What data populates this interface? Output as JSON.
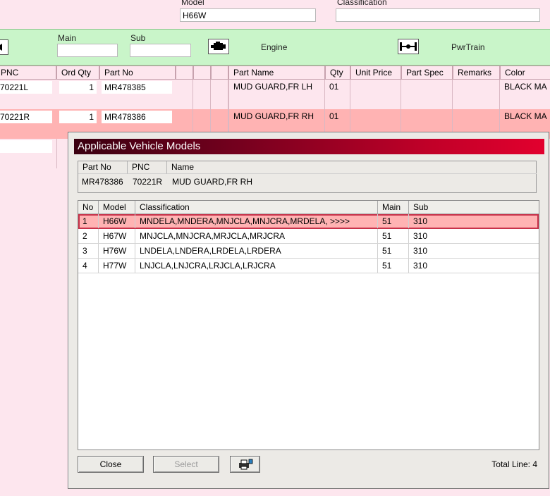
{
  "top": {
    "model_label": "Model",
    "model_value": "H66W",
    "classification_label": "Classification",
    "classification_value": ""
  },
  "toolbar": {
    "main_label": "Main",
    "sub_label": "Sub",
    "engine_label": "Engine",
    "pwrtrain_label": "PwrTrain",
    "engine_icon": "engine-icon",
    "pwrtrain_icon": "axle-icon",
    "colors": {
      "toolbar_bg": "#c9f5c9",
      "page_bg": "#fde6ee",
      "selected_row": "#ffb3b3"
    }
  },
  "parts_grid": {
    "headers": {
      "pnc": "PNC",
      "ord_qty": "Ord Qty",
      "part_no": "Part No",
      "part_name": "Part Name",
      "qty": "Qty",
      "unit_price": "Unit Price",
      "part_spec": "Part Spec",
      "remarks": "Remarks",
      "color": "Color"
    },
    "rows": [
      {
        "pnc": "70221L",
        "ord_qty": "1",
        "part_no": "MR478385",
        "part_name": "MUD GUARD,FR LH",
        "qty": "01",
        "color": "BLACK MA"
      },
      {
        "pnc": "70221R",
        "ord_qty": "1",
        "part_no": "MR478386",
        "part_name": "MUD GUARD,FR RH",
        "qty": "01",
        "color": "BLACK MA"
      }
    ]
  },
  "dialog": {
    "title": "Applicable Vehicle Models",
    "info_headers": {
      "part_no": "Part No",
      "pnc": "PNC",
      "name": "Name"
    },
    "info_values": {
      "part_no": "MR478386",
      "pnc": "70221R",
      "name": "MUD GUARD,FR RH"
    },
    "list_headers": {
      "no": "No",
      "model": "Model",
      "classification": "Classification",
      "main": "Main",
      "sub": "Sub"
    },
    "rows": [
      {
        "no": "1",
        "model": "H66W",
        "classification": "MNDELA,MNDERA,MNJCLA,MNJCRA,MRDELA,  >>>>",
        "main": "51",
        "sub": "310"
      },
      {
        "no": "2",
        "model": "H67W",
        "classification": "MNJCLA,MNJCRA,MRJCLA,MRJCRA",
        "main": "51",
        "sub": "310"
      },
      {
        "no": "3",
        "model": "H76W",
        "classification": "LNDELA,LNDERA,LRDELA,LRDERA",
        "main": "51",
        "sub": "310"
      },
      {
        "no": "4",
        "model": "H77W",
        "classification": "LNJCLA,LNJCRA,LRJCLA,LRJCRA",
        "main": "51",
        "sub": "310"
      }
    ],
    "close_label": "Close",
    "select_label": "Select",
    "print_icon": "printer-icon",
    "total_line": "Total Line: 4"
  }
}
